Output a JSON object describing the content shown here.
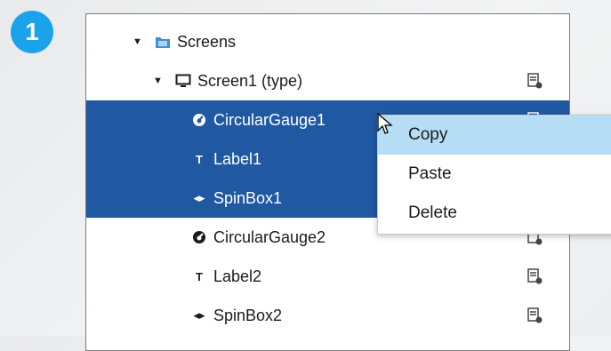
{
  "step": {
    "number": "1"
  },
  "tree": {
    "rows": [
      {
        "label": "Screens",
        "icon": "folder-icon",
        "caret": "▼",
        "selected": false,
        "has_edit": false
      },
      {
        "label": "Screen1 (type)",
        "icon": "monitor-icon",
        "caret": "▼",
        "selected": false,
        "has_edit": true
      },
      {
        "label": "CircularGauge1",
        "icon": "gauge-icon",
        "selected": true,
        "has_edit": true
      },
      {
        "label": "Label1",
        "icon": "text-icon",
        "glyph": "T",
        "selected": true,
        "has_edit": false
      },
      {
        "label": "SpinBox1",
        "icon": "spinbox-icon",
        "glyph": "◂▸",
        "selected": true,
        "has_edit": false
      },
      {
        "label": "CircularGauge2",
        "icon": "gauge-icon",
        "selected": false,
        "has_edit": true
      },
      {
        "label": "Label2",
        "icon": "text-icon",
        "glyph": "T",
        "selected": false,
        "has_edit": true
      },
      {
        "label": "SpinBox2",
        "icon": "spinbox-icon",
        "glyph": "◂▸",
        "selected": false,
        "has_edit": true
      }
    ]
  },
  "context_menu": {
    "items": [
      {
        "label": "Copy",
        "hovered": true
      },
      {
        "label": "Paste",
        "hovered": false
      },
      {
        "label": "Delete",
        "hovered": false
      }
    ]
  },
  "colors": {
    "selection": "#2058a1",
    "menu_hover": "#b6ddf6",
    "badge": "#1aa3ea"
  }
}
